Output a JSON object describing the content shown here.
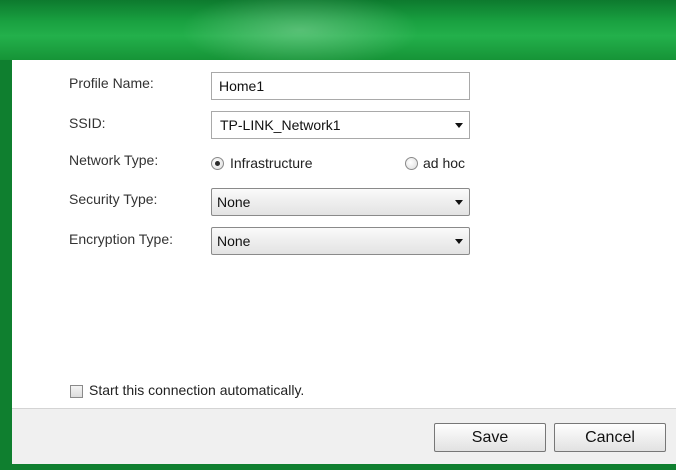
{
  "form": {
    "profile_name": {
      "label": "Profile Name:",
      "value": "Home1"
    },
    "ssid": {
      "label": "SSID:",
      "value": "TP-LINK_Network1"
    },
    "network_type": {
      "label": "Network Type:",
      "options": [
        {
          "label": "Infrastructure",
          "selected": true
        },
        {
          "label": "ad hoc",
          "selected": false
        }
      ]
    },
    "security_type": {
      "label": "Security Type:",
      "value": "None"
    },
    "encryption_type": {
      "label": "Encryption Type:",
      "value": "None"
    },
    "auto_connect": {
      "label": "Start this connection automatically.",
      "checked": false
    }
  },
  "footer": {
    "save_label": "Save",
    "cancel_label": "Cancel"
  },
  "colors": {
    "frame_green": "#0f7f2f",
    "title_green": "#23b04b"
  }
}
